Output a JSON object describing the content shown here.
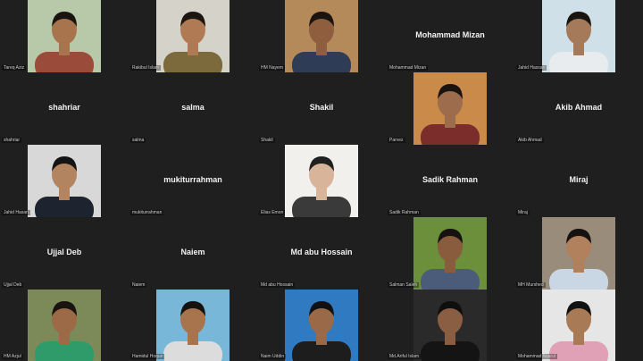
{
  "participants": [
    {
      "name": "Tareq Aziz",
      "display": "",
      "video": true,
      "bg": "#b7c9a8",
      "shirt": "#9b4b3a",
      "skin": "#a7744e",
      "hair": "#1a1410"
    },
    {
      "name": "Rakibul Islam",
      "display": "",
      "video": true,
      "bg": "#d5d2c9",
      "shirt": "#7d6a3c",
      "skin": "#b07a54",
      "hair": "#1c1612"
    },
    {
      "name": "HM Nayem",
      "display": "",
      "video": true,
      "bg": "#b58a5a",
      "shirt": "#2e3c55",
      "skin": "#8e5e3e",
      "hair": "#1a140f"
    },
    {
      "name": "Mohammad Mizan",
      "display": "Mohammad Mizan",
      "video": false
    },
    {
      "name": "Jahid Hassan",
      "display": "",
      "video": true,
      "bg": "#cfe0e8",
      "shirt": "#e8ecef",
      "skin": "#a47a5a",
      "hair": "#1a1410"
    },
    {
      "name": "shahriar",
      "display": "shahriar",
      "video": false
    },
    {
      "name": "salma",
      "display": "salma",
      "video": false
    },
    {
      "name": "Shakil",
      "display": "Shakil",
      "video": false
    },
    {
      "name": "Parvez",
      "display": "",
      "video": true,
      "bg": "#c98a4a",
      "shirt": "#7a2d2a",
      "skin": "#9c6c4c",
      "hair": "#1a1410"
    },
    {
      "name": "Akib Ahmad",
      "display": "Akib Ahmad",
      "video": false
    },
    {
      "name": "Jahid Hasan",
      "display": "",
      "video": true,
      "bg": "#d8d8d8",
      "shirt": "#1d2430",
      "skin": "#b38460",
      "hair": "#141414"
    },
    {
      "name": "mukiturrahman",
      "display": "mukiturrahman",
      "video": false
    },
    {
      "name": "Elias Emon",
      "display": "",
      "video": true,
      "bg": "#f2f0ec",
      "shirt": "#3a3a3a",
      "skin": "#d7b49a",
      "hair": "#202020"
    },
    {
      "name": "Sadik Rahman",
      "display": "Sadik Rahman",
      "video": false
    },
    {
      "name": "Miraj",
      "display": "Miraj",
      "video": false
    },
    {
      "name": "Ujjal Deb",
      "display": "Ujjal Deb",
      "video": false
    },
    {
      "name": "Naiem",
      "display": "Naiem",
      "video": false
    },
    {
      "name": "Md abu Hossain",
      "display": "Md abu Hossain",
      "video": false
    },
    {
      "name": "Salman Saleh",
      "display": "",
      "video": true,
      "bg": "#6b8f3a",
      "shirt": "#4a5c7a",
      "skin": "#8a5c3e",
      "hair": "#161210"
    },
    {
      "name": "MH Murshed",
      "display": "",
      "video": true,
      "bg": "#9a8c7a",
      "shirt": "#c9d7e4",
      "skin": "#b1805c",
      "hair": "#151210"
    },
    {
      "name": "HM Azjul",
      "display": "",
      "video": true,
      "bg": "#7c8a5a",
      "shirt": "#2f9a6a",
      "skin": "#9c6a46",
      "hair": "#1a1410"
    },
    {
      "name": "Hamidul Hoque",
      "display": "",
      "video": true,
      "bg": "#78b7d8",
      "shirt": "#dcdcdc",
      "skin": "#a8744e",
      "hair": "#161210"
    },
    {
      "name": "Naim Uddin",
      "display": "",
      "video": true,
      "bg": "#2f7ac0",
      "shirt": "#1d1d1d",
      "skin": "#9a6a48",
      "hair": "#111111"
    },
    {
      "name": "Md.Ariful Islam",
      "display": "",
      "video": true,
      "bg": "#2a2a2a",
      "shirt": "#141414",
      "skin": "#8a5e42",
      "hair": "#0f0f0f"
    },
    {
      "name": "Mohammad Anarul",
      "display": "",
      "video": true,
      "bg": "#e6e6e6",
      "shirt": "#e0a0b6",
      "skin": "#a97a56",
      "hair": "#121212"
    }
  ]
}
